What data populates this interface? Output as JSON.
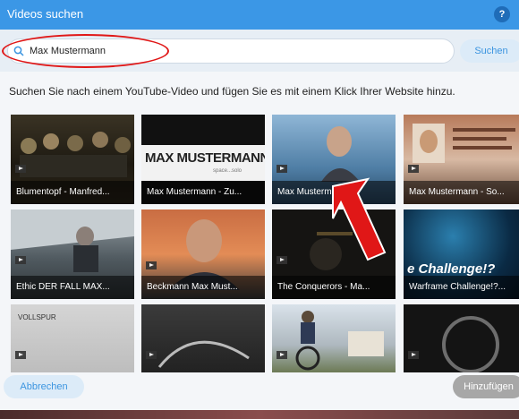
{
  "dialog": {
    "title": "Videos suchen",
    "help_label": "?"
  },
  "search": {
    "value": "Max Mustermann",
    "button_label": "Suchen",
    "icon": "search-icon"
  },
  "instruction": "Suchen Sie nach einem YouTube-Video und fügen Sie es mit einem Klick Ihrer Website hinzu.",
  "videos": [
    {
      "title": "Blumentopf - Manfred..."
    },
    {
      "title": "Max Mustermann - Zu..."
    },
    {
      "title": "Max Musterm..."
    },
    {
      "title": "Max Mustermann - So..."
    },
    {
      "title": "Ethic DER FALL MAX..."
    },
    {
      "title": "Beckmann Max Must..."
    },
    {
      "title": "The Conquerors - Ma..."
    },
    {
      "title": "Warframe Challenge!?..."
    },
    {
      "title": ""
    },
    {
      "title": ""
    },
    {
      "title": ""
    },
    {
      "title": ""
    }
  ],
  "thumb_text": {
    "max_mustermann": "MAX MUSTERMANN",
    "max_sub": "space...solo",
    "challenge": "e Challenge!?",
    "vollsp": "VOLLSPUR"
  },
  "footer": {
    "cancel_label": "Abbrechen",
    "add_label": "Hinzufügen"
  },
  "annotation_color": "#e01717"
}
